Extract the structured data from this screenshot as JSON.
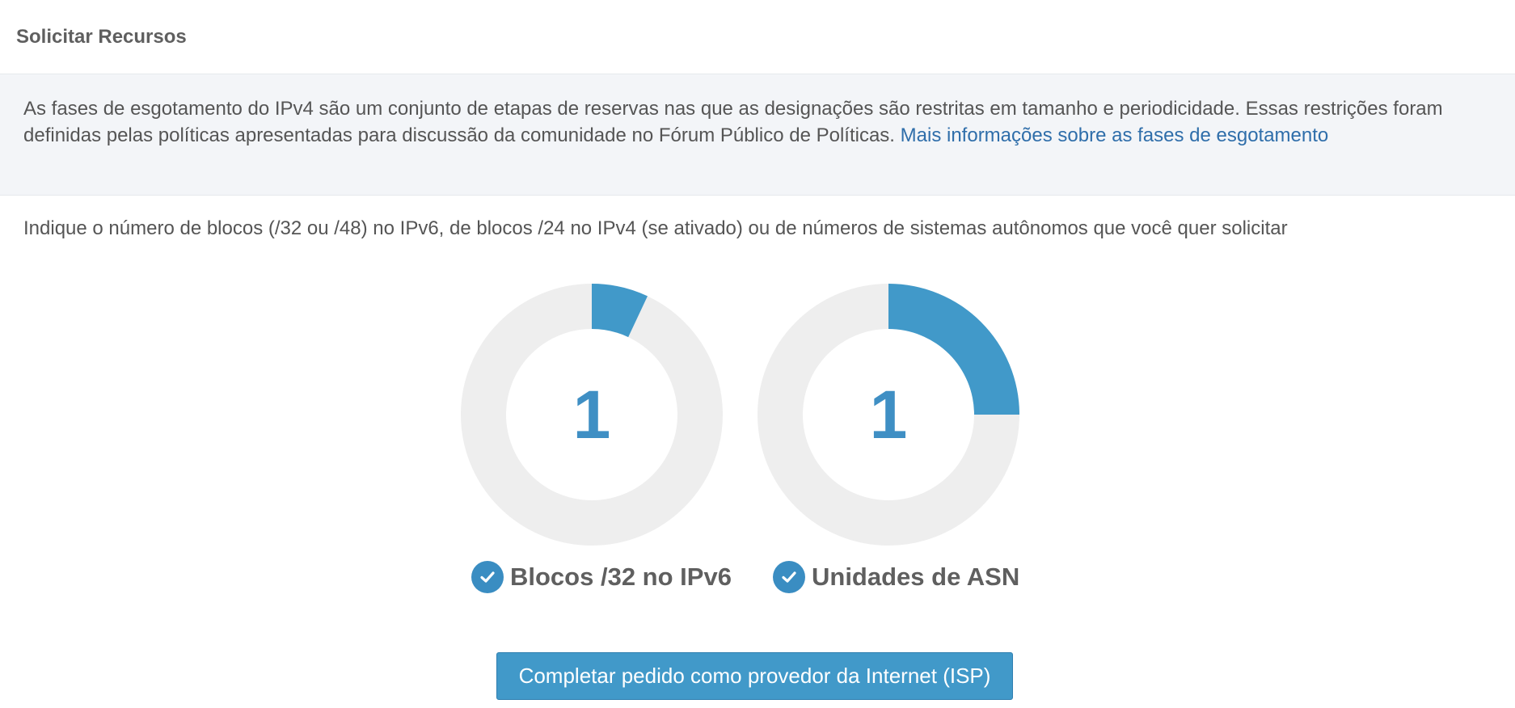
{
  "header": {
    "title": "Solicitar Recursos"
  },
  "info": {
    "text": "As fases de esgotamento do IPv4 são um conjunto de etapas de reservas nas que as designações são restritas em tamanho e periodicidade. Essas restrições foram definidas pelas políticas apresentadas para discussão da comunidade no Fórum Público de Políticas.",
    "link_text": "Mais informações sobre as fases de esgotamento"
  },
  "instruction": "Indique o número de blocos (/32 ou /48) no IPv6, de blocos /24 no IPv4 (se ativado) ou de números de sistemas autônomos que você quer solicitar",
  "charts": [
    {
      "value": "1",
      "label": "Blocos /32 no IPv6",
      "fill_fraction": 0.07,
      "checked": true
    },
    {
      "value": "1",
      "label": "Unidades de ASN",
      "fill_fraction": 0.25,
      "checked": true
    }
  ],
  "colors": {
    "accent": "#4199c9",
    "track": "#eeeeee",
    "link": "#2f6eaa"
  },
  "cta": {
    "label": "Completar pedido como provedor da Internet (ISP)"
  }
}
